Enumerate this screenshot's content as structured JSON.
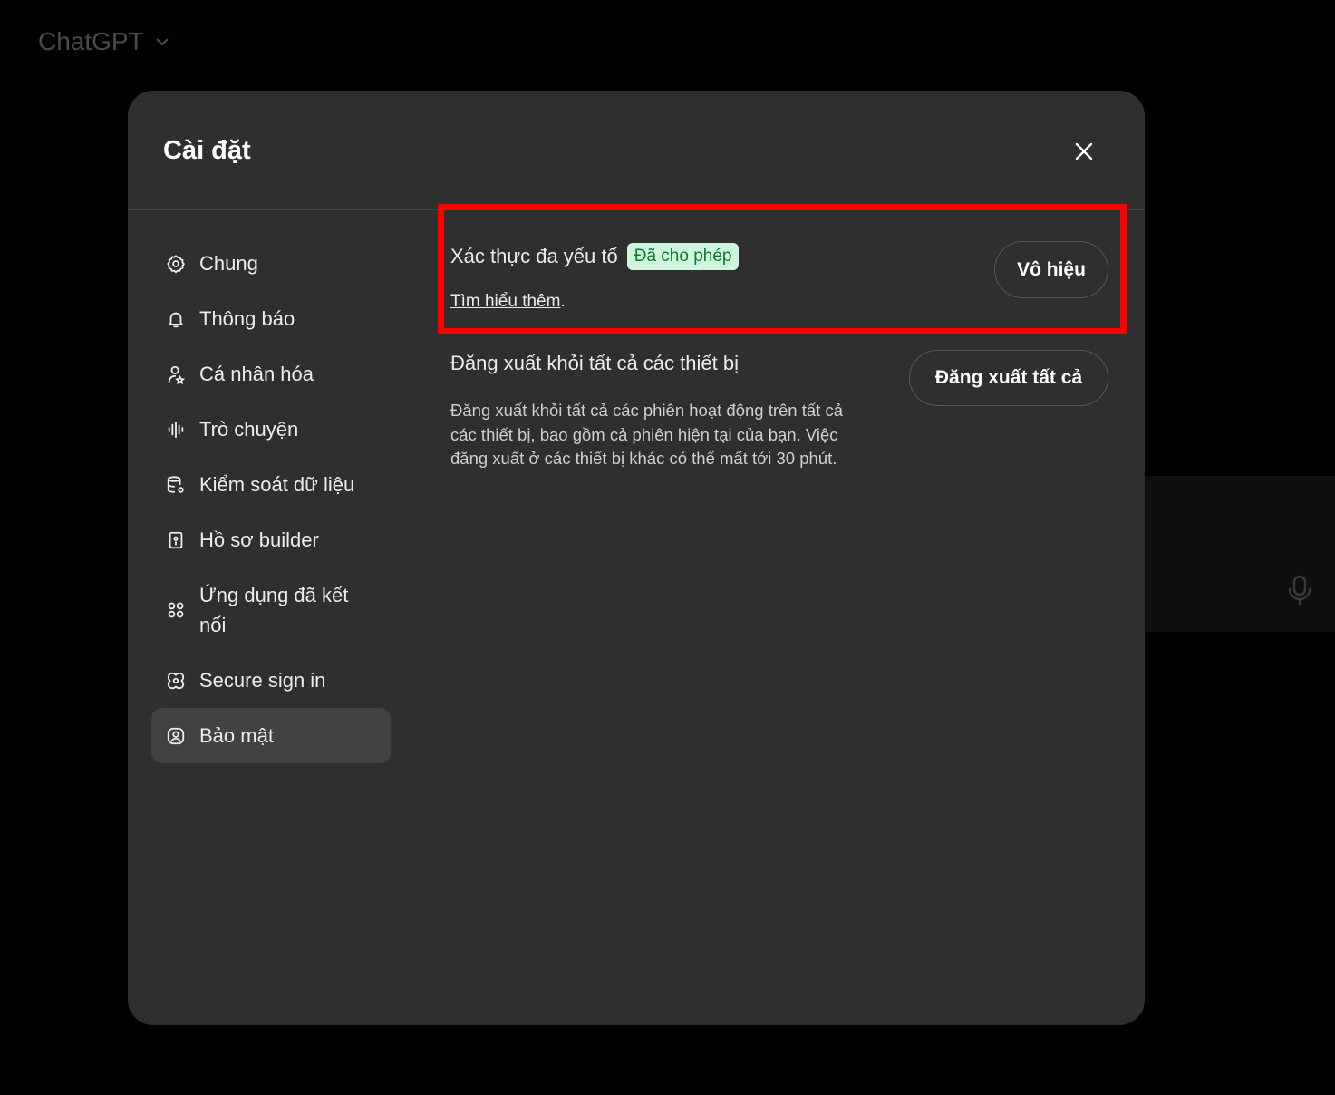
{
  "background": {
    "app_title": "ChatGPT",
    "title_icon": "chevron-down-icon",
    "mic_icon": "microphone-icon"
  },
  "modal": {
    "title": "Cài đặt",
    "close_icon": "close-icon"
  },
  "sidebar": {
    "items": [
      {
        "label": "Chung",
        "icon": "gear-icon",
        "active": false
      },
      {
        "label": "Thông báo",
        "icon": "bell-icon",
        "active": false
      },
      {
        "label": "Cá nhân hóa",
        "icon": "person-icon",
        "active": false
      },
      {
        "label": "Trò chuyện",
        "icon": "waveform-icon",
        "active": false
      },
      {
        "label": "Kiểm soát dữ liệu",
        "icon": "database-gear-icon",
        "active": false
      },
      {
        "label": "Hồ sơ builder",
        "icon": "id-card-icon",
        "active": false
      },
      {
        "label": "Ứng dụng đã kết nối",
        "icon": "apps-icon",
        "active": false
      },
      {
        "label": "Secure sign in",
        "icon": "secure-signin-icon",
        "active": false
      },
      {
        "label": "Bảo mật",
        "icon": "shield-user-icon",
        "active": true
      }
    ]
  },
  "security": {
    "mfa": {
      "title": "Xác thực đa yếu tố",
      "status_badge": "Đã cho phép",
      "learn_more": "Tìm hiểu thêm",
      "learn_more_suffix": ".",
      "disable_button": "Vô hiệu"
    },
    "logout_all": {
      "title": "Đăng xuất khỏi tất cả các thiết bị",
      "description": "Đăng xuất khỏi tất cả các phiên hoạt động trên tất cả các thiết bị, bao gồm cả phiên hiện tại của bạn. Việc đăng xuất ở các thiết bị khác có thể mất tới 30 phút.",
      "button": "Đăng xuất tất cả"
    }
  },
  "colors": {
    "modal_bg": "#2f2f2f",
    "active_item_bg": "#424242",
    "badge_bg": "#d1f5dc",
    "badge_text": "#0a7a30",
    "highlight": "#ff0000"
  }
}
